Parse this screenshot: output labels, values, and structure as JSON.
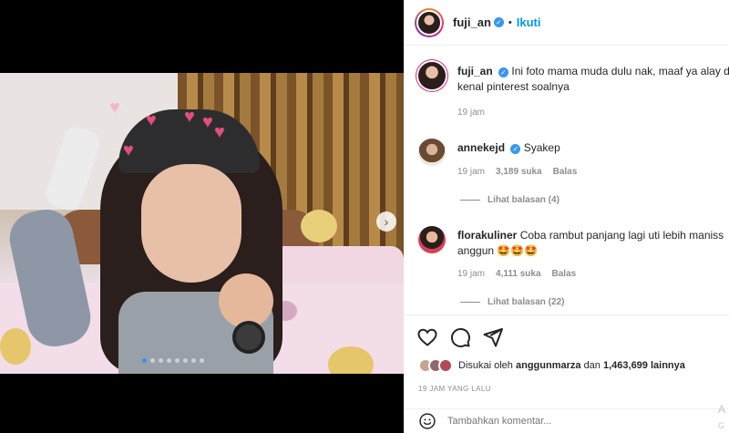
{
  "header": {
    "username": "fuji_an",
    "separator": "•",
    "follow_label": "Ikuti"
  },
  "caption": {
    "username": "fuji_an",
    "text": "Ini foto mama muda dulu nak, maaf ya alay d",
    "text_line2": "kenal pinterest soalnya",
    "time": "19 jam"
  },
  "comments": [
    {
      "username": "annekejd",
      "text": "Syakep",
      "time": "19 jam",
      "likes": "3,189 suka",
      "reply": "Balas",
      "view_replies": "Lihat balasan (4)"
    },
    {
      "username": "florakuliner",
      "text": "Coba rambut panjang lagi uti lebih maniss",
      "text_line2": "anggun 🤩🤩🤩",
      "time": "19 jam",
      "likes": "4,111 suka",
      "reply": "Balas",
      "view_replies": "Lihat balasan (22)"
    }
  ],
  "likes_summary": {
    "prefix": "Disukai oleh",
    "user": "anggunmarza",
    "middle": "dan",
    "count": "1,463,699 lainnya"
  },
  "post_time": "19 JAM YANG LALU",
  "add_comment": {
    "placeholder": "Tambahkan komentar..."
  },
  "side_fragment": {
    "line1": "A",
    "line2": "G"
  },
  "carousel": {
    "slide_count": 8,
    "active_index": 0
  },
  "colors": {
    "link_blue": "#0095f6",
    "verified_blue": "#3897f0"
  }
}
